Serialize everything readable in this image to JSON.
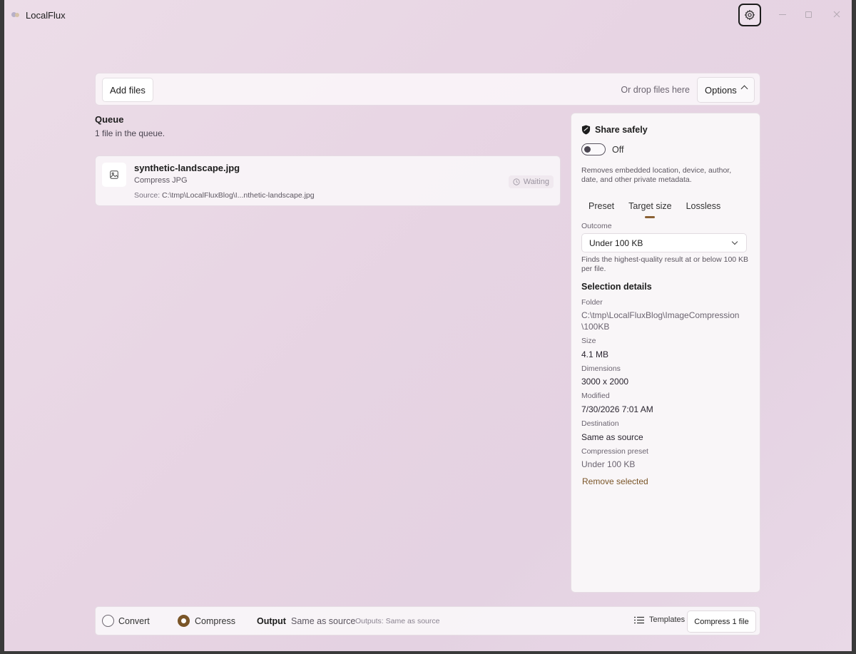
{
  "app": {
    "title": "LocalFlux"
  },
  "top_bar": {
    "add_files_label": "Add files",
    "drop_hint": "Or drop files here",
    "options_label": "Options"
  },
  "queue": {
    "title": "Queue",
    "count_text": "1 file in the queue.",
    "items": [
      {
        "name": "synthetic-landscape.jpg",
        "action": "Compress JPG",
        "source_label": "Source:",
        "source_path": "C:\\tmp\\LocalFluxBlog\\I...nthetic-landscape.jpg",
        "status": "Waiting"
      }
    ]
  },
  "side_panel": {
    "share_safely_title": "Share safely",
    "toggle_state": "Off",
    "description": "Removes embedded location, device, author, date, and other private metadata.",
    "tabs": [
      {
        "label": "Preset"
      },
      {
        "label": "Target size"
      },
      {
        "label": "Lossless"
      }
    ],
    "active_tab": "Target size",
    "outcome_label": "Outcome",
    "outcome_value": "Under 100 KB",
    "outcome_hint": "Finds the highest-quality result at or below 100 KB per file.",
    "selection_title": "Selection details",
    "details": {
      "folder_label": "Folder",
      "folder_value": "C:\\tmp\\LocalFluxBlog\\ImageCompression\n\\100KB",
      "size_label": "Size",
      "size_value": "4.1 MB",
      "dimensions_label": "Dimensions",
      "dimensions_value": "3000 x 2000",
      "modified_label": "Modified",
      "modified_value": "7/30/2026 7:01 AM",
      "destination_label": "Destination",
      "destination_value": "Same as source",
      "preset_label": "Compression preset",
      "preset_value": "Under 100 KB"
    },
    "remove_label": "Remove selected"
  },
  "bottom_bar": {
    "convert_label": "Convert",
    "compress_label": "Compress",
    "selected_mode": "Compress",
    "output_label": "Output",
    "output_value": "Same as source",
    "output_summary": "Outputs: Same as source",
    "templates_label": "Templates",
    "compress_button_label": "Compress 1 file"
  },
  "colors": {
    "accent": "#7a5528",
    "background": "#e7d4e3"
  }
}
